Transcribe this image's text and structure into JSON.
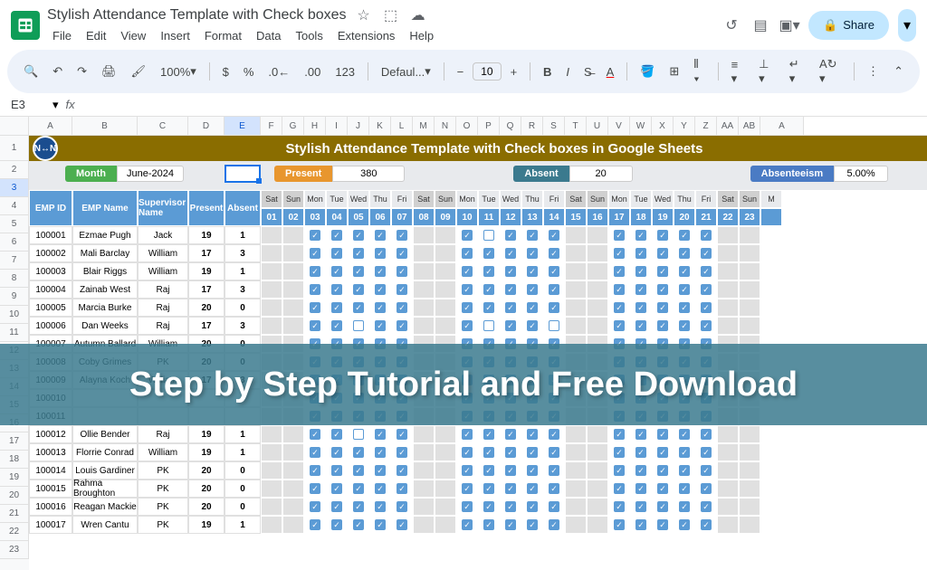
{
  "header": {
    "doc_title": "Stylish Attendance Template with Check boxes",
    "menus": [
      "File",
      "Edit",
      "View",
      "Insert",
      "Format",
      "Data",
      "Tools",
      "Extensions",
      "Help"
    ],
    "share": "Share"
  },
  "toolbar": {
    "zoom": "100%",
    "font": "Defaul...",
    "font_size": "10"
  },
  "formula": {
    "cell_ref": "E3"
  },
  "columns": [
    "A",
    "B",
    "C",
    "D",
    "E",
    "F",
    "G",
    "H",
    "I",
    "J",
    "K",
    "L",
    "M",
    "N",
    "O",
    "P",
    "Q",
    "R",
    "S",
    "T",
    "U",
    "V",
    "W",
    "X",
    "Y",
    "Z",
    "AA",
    "AB",
    "A"
  ],
  "selected_col": "E",
  "rows": [
    1,
    2,
    3,
    4,
    5,
    6,
    7,
    8,
    9,
    10,
    11,
    12,
    13,
    14,
    15,
    16,
    17,
    18,
    19,
    20,
    21,
    22,
    23
  ],
  "title": "Stylish Attendance Template with Check boxes in Google Sheets",
  "summary": {
    "month_label": "Month",
    "month_val": "June-2024",
    "present_label": "Present",
    "present_val": "380",
    "absent_label": "Absent",
    "absent_val": "20",
    "absentee_label": "Absenteeism",
    "absentee_val": "5.00%"
  },
  "table_headers": [
    "EMP ID",
    "EMP Name",
    "Supervisor Name",
    "Present",
    "Absent"
  ],
  "days": [
    {
      "name": "Sat",
      "num": "01",
      "weekend": true
    },
    {
      "name": "Sun",
      "num": "02",
      "weekend": true
    },
    {
      "name": "Mon",
      "num": "03"
    },
    {
      "name": "Tue",
      "num": "04"
    },
    {
      "name": "Wed",
      "num": "05"
    },
    {
      "name": "Thu",
      "num": "06"
    },
    {
      "name": "Fri",
      "num": "07"
    },
    {
      "name": "Sat",
      "num": "08",
      "weekend": true
    },
    {
      "name": "Sun",
      "num": "09",
      "weekend": true
    },
    {
      "name": "Mon",
      "num": "10"
    },
    {
      "name": "Tue",
      "num": "11"
    },
    {
      "name": "Wed",
      "num": "12"
    },
    {
      "name": "Thu",
      "num": "13"
    },
    {
      "name": "Fri",
      "num": "14"
    },
    {
      "name": "Sat",
      "num": "15",
      "weekend": true
    },
    {
      "name": "Sun",
      "num": "16",
      "weekend": true
    },
    {
      "name": "Mon",
      "num": "17"
    },
    {
      "name": "Tue",
      "num": "18"
    },
    {
      "name": "Wed",
      "num": "19"
    },
    {
      "name": "Thu",
      "num": "20"
    },
    {
      "name": "Fri",
      "num": "21"
    },
    {
      "name": "Sat",
      "num": "22",
      "weekend": true
    },
    {
      "name": "Sun",
      "num": "23",
      "weekend": true
    },
    {
      "name": "M",
      "num": ""
    }
  ],
  "employees": [
    {
      "id": "100001",
      "name": "Ezmae Pugh",
      "sup": "Jack",
      "p": "19",
      "a": "1",
      "checks": [
        0,
        0,
        1,
        1,
        1,
        1,
        1,
        0,
        0,
        1,
        0,
        1,
        1,
        1,
        0,
        0,
        1,
        1,
        1,
        1,
        1,
        0,
        0
      ]
    },
    {
      "id": "100002",
      "name": "Mali Barclay",
      "sup": "William",
      "p": "17",
      "a": "3",
      "checks": [
        0,
        0,
        1,
        1,
        1,
        1,
        1,
        0,
        0,
        1,
        1,
        1,
        1,
        1,
        0,
        0,
        1,
        1,
        1,
        1,
        1,
        0,
        0
      ]
    },
    {
      "id": "100003",
      "name": "Blair Riggs",
      "sup": "William",
      "p": "19",
      "a": "1",
      "checks": [
        0,
        0,
        1,
        1,
        1,
        1,
        1,
        0,
        0,
        1,
        1,
        1,
        1,
        1,
        0,
        0,
        1,
        1,
        1,
        1,
        1,
        0,
        0
      ]
    },
    {
      "id": "100004",
      "name": "Zainab West",
      "sup": "Raj",
      "p": "17",
      "a": "3",
      "checks": [
        0,
        0,
        1,
        1,
        1,
        1,
        1,
        0,
        0,
        1,
        1,
        1,
        1,
        1,
        0,
        0,
        1,
        1,
        1,
        1,
        1,
        0,
        0
      ]
    },
    {
      "id": "100005",
      "name": "Marcia Burke",
      "sup": "Raj",
      "p": "20",
      "a": "0",
      "checks": [
        0,
        0,
        1,
        1,
        1,
        1,
        1,
        0,
        0,
        1,
        1,
        1,
        1,
        1,
        0,
        0,
        1,
        1,
        1,
        1,
        1,
        0,
        0
      ]
    },
    {
      "id": "100006",
      "name": "Dan Weeks",
      "sup": "Raj",
      "p": "17",
      "a": "3",
      "checks": [
        0,
        0,
        1,
        1,
        0,
        1,
        1,
        0,
        0,
        1,
        0,
        1,
        1,
        0,
        0,
        0,
        1,
        1,
        1,
        1,
        1,
        0,
        0
      ]
    },
    {
      "id": "100007",
      "name": "Autumn Ballard",
      "sup": "William",
      "p": "20",
      "a": "0",
      "checks": [
        0,
        0,
        1,
        1,
        1,
        1,
        1,
        0,
        0,
        1,
        1,
        1,
        1,
        1,
        0,
        0,
        1,
        1,
        1,
        1,
        1,
        0,
        0
      ]
    },
    {
      "id": "100008",
      "name": "Coby Grimes",
      "sup": "PK",
      "p": "20",
      "a": "0",
      "checks": [
        0,
        0,
        1,
        1,
        1,
        1,
        1,
        0,
        0,
        1,
        1,
        1,
        1,
        1,
        0,
        0,
        1,
        1,
        1,
        1,
        1,
        0,
        0
      ]
    },
    {
      "id": "100009",
      "name": "Alayna Koch",
      "sup": "William",
      "p": "17",
      "a": "3",
      "checks": [
        0,
        0,
        1,
        1,
        1,
        1,
        1,
        0,
        0,
        1,
        1,
        1,
        1,
        1,
        0,
        0,
        1,
        1,
        1,
        1,
        1,
        0,
        0
      ]
    },
    {
      "id": "100010",
      "name": "",
      "sup": "",
      "p": "",
      "a": "",
      "checks": [
        0,
        0,
        1,
        1,
        1,
        1,
        1,
        0,
        0,
        1,
        1,
        1,
        1,
        1,
        0,
        0,
        1,
        1,
        1,
        1,
        1,
        0,
        0
      ]
    },
    {
      "id": "100011",
      "name": "",
      "sup": "",
      "p": "",
      "a": "",
      "checks": [
        0,
        0,
        1,
        1,
        1,
        1,
        1,
        0,
        0,
        1,
        1,
        1,
        1,
        1,
        0,
        0,
        1,
        1,
        1,
        1,
        1,
        0,
        0
      ]
    },
    {
      "id": "100012",
      "name": "Ollie Bender",
      "sup": "Raj",
      "p": "19",
      "a": "1",
      "checks": [
        0,
        0,
        1,
        1,
        0,
        1,
        1,
        0,
        0,
        1,
        1,
        1,
        1,
        1,
        0,
        0,
        1,
        1,
        1,
        1,
        1,
        0,
        0
      ]
    },
    {
      "id": "100013",
      "name": "Florrie Conrad",
      "sup": "William",
      "p": "19",
      "a": "1",
      "checks": [
        0,
        0,
        1,
        1,
        1,
        1,
        1,
        0,
        0,
        1,
        1,
        1,
        1,
        1,
        0,
        0,
        1,
        1,
        1,
        1,
        1,
        0,
        0
      ]
    },
    {
      "id": "100014",
      "name": "Louis Gardiner",
      "sup": "PK",
      "p": "20",
      "a": "0",
      "checks": [
        0,
        0,
        1,
        1,
        1,
        1,
        1,
        0,
        0,
        1,
        1,
        1,
        1,
        1,
        0,
        0,
        1,
        1,
        1,
        1,
        1,
        0,
        0
      ]
    },
    {
      "id": "100015",
      "name": "Rahma Broughton",
      "sup": "PK",
      "p": "20",
      "a": "0",
      "checks": [
        0,
        0,
        1,
        1,
        1,
        1,
        1,
        0,
        0,
        1,
        1,
        1,
        1,
        1,
        0,
        0,
        1,
        1,
        1,
        1,
        1,
        0,
        0
      ]
    },
    {
      "id": "100016",
      "name": "Reagan Mackie",
      "sup": "PK",
      "p": "20",
      "a": "0",
      "checks": [
        0,
        0,
        1,
        1,
        1,
        1,
        1,
        0,
        0,
        1,
        1,
        1,
        1,
        1,
        0,
        0,
        1,
        1,
        1,
        1,
        1,
        0,
        0
      ]
    },
    {
      "id": "100017",
      "name": "Wren Cantu",
      "sup": "PK",
      "p": "19",
      "a": "1",
      "checks": [
        0,
        0,
        1,
        1,
        1,
        1,
        1,
        0,
        0,
        1,
        1,
        1,
        1,
        1,
        0,
        0,
        1,
        1,
        1,
        1,
        1,
        0,
        0
      ]
    }
  ],
  "overlay_text": "Step by Step Tutorial and Free Download"
}
